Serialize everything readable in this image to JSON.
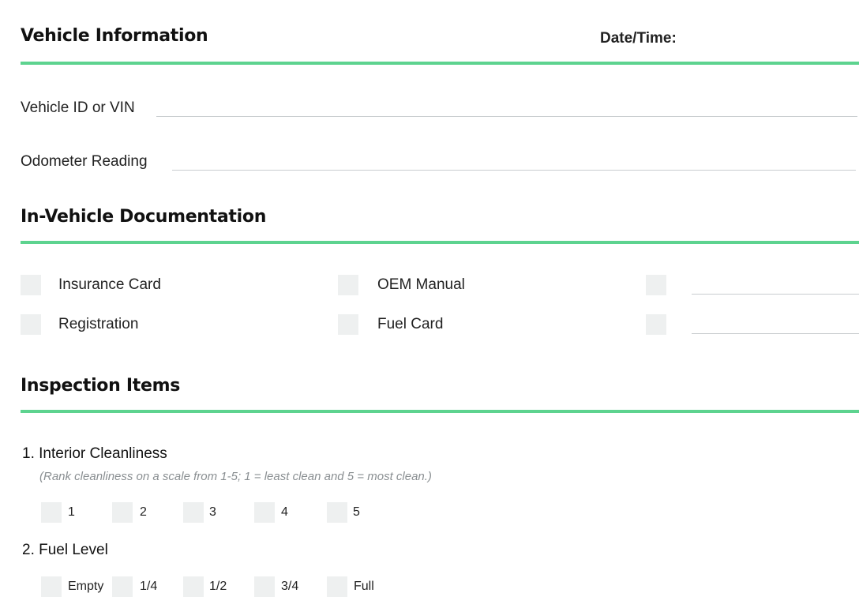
{
  "vehicle_info": {
    "title": "Vehicle Information",
    "date_label": "Date/Time:",
    "vin_label": "Vehicle ID or VIN",
    "odometer_label": "Odometer Reading"
  },
  "documentation": {
    "title": "In-Vehicle Documentation",
    "items": [
      "Insurance Card",
      "OEM Manual",
      "Registration",
      "Fuel Card"
    ]
  },
  "inspection": {
    "title": "Inspection Items",
    "q1": {
      "title": "1. Interior Cleanliness",
      "hint": "(Rank cleanliness on a scale from 1-5; 1 = least clean and 5 = most clean.)",
      "options": [
        "1",
        "2",
        "3",
        "4",
        "5"
      ]
    },
    "q2": {
      "title": "2. Fuel Level",
      "options": [
        "Empty",
        "1/4",
        "1/2",
        "3/4",
        "Full"
      ]
    }
  },
  "colors": {
    "accent": "#5dd38f",
    "checkbox": "#eef0f0",
    "line": "#c9cdcf"
  }
}
